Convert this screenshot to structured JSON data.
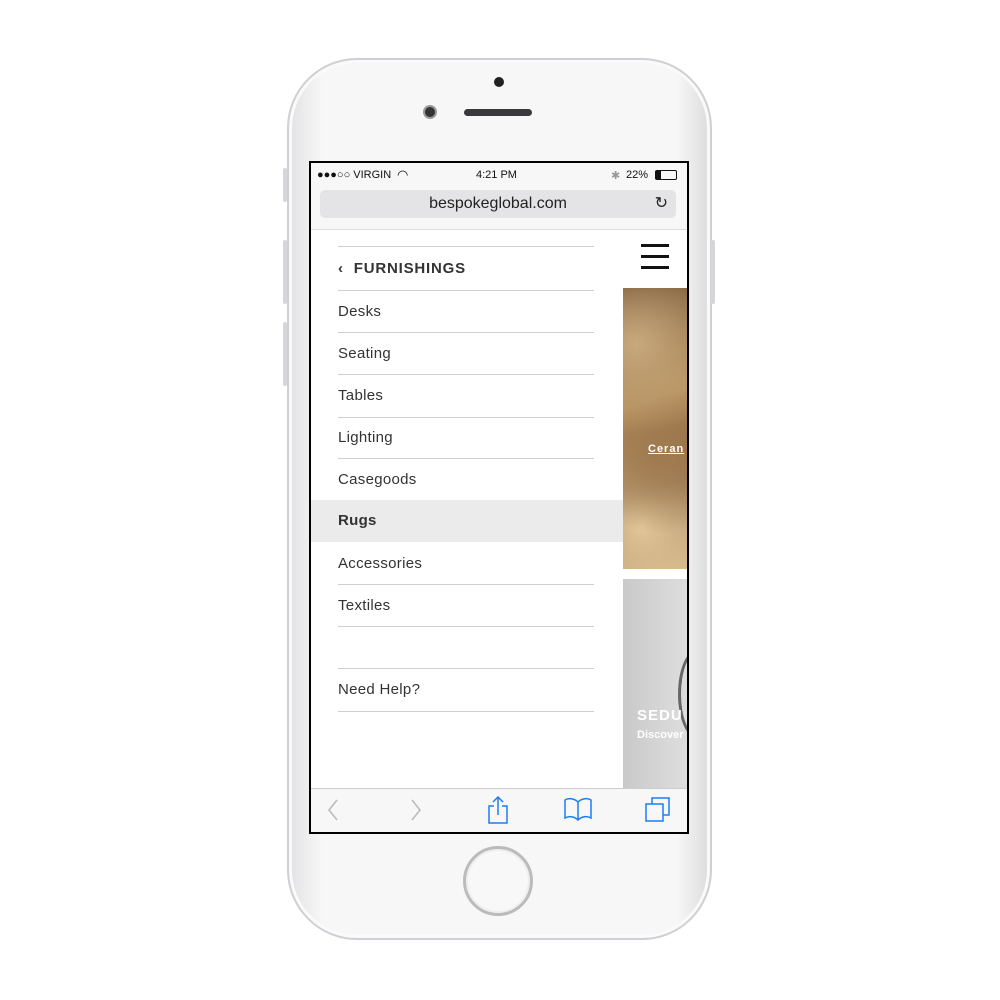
{
  "status": {
    "carrier": "●●●○○ VIRGIN",
    "time": "4:21 PM",
    "battery": "22%"
  },
  "browser": {
    "url": "bespokeglobal.com"
  },
  "menu": {
    "header": "FURNISHINGS",
    "items": [
      {
        "label": "Desks"
      },
      {
        "label": "Seating"
      },
      {
        "label": "Tables"
      },
      {
        "label": "Lighting"
      },
      {
        "label": "Casegoods"
      },
      {
        "label": "Rugs",
        "active": true
      },
      {
        "label": "Accessories"
      },
      {
        "label": "Textiles"
      }
    ],
    "help": "Need Help?"
  },
  "page": {
    "image_caption": "Ceran",
    "promo_title": "SEDU",
    "promo_sub": "Discover"
  },
  "colors": {
    "accent": "#1a7ef5",
    "active_bg": "#ebebeb"
  }
}
